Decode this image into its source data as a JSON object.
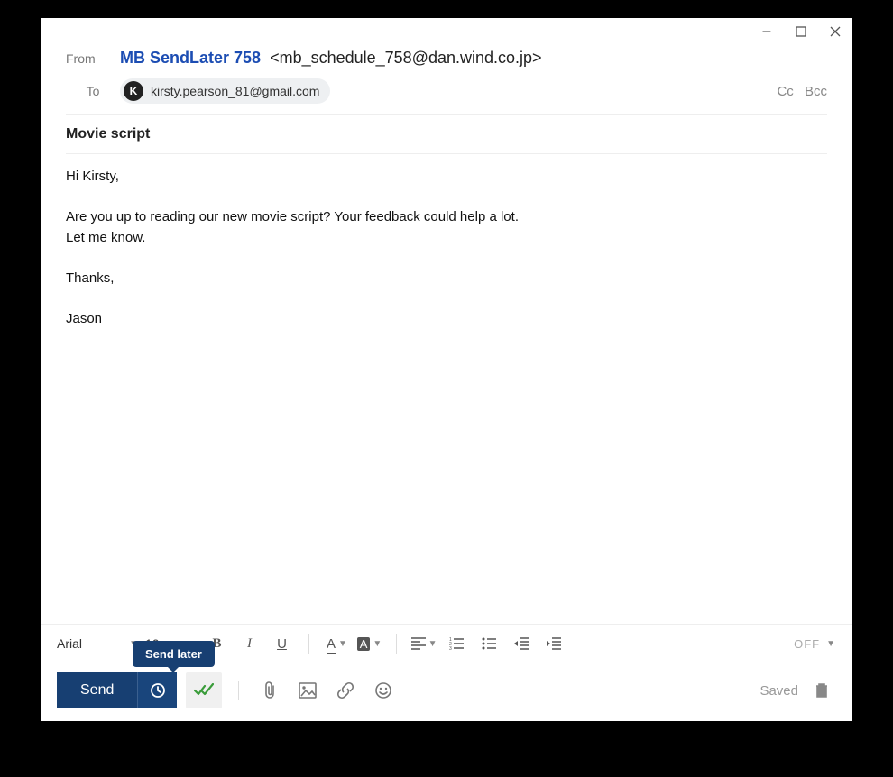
{
  "titlebar": {
    "minimize": "–",
    "maximize": "□",
    "close": "✕"
  },
  "header": {
    "from_label": "From",
    "from_name": "MB SendLater 758",
    "from_address": "<mb_schedule_758@dan.wind.co.jp>",
    "to_label": "To",
    "recipient": {
      "initial": "K",
      "address": "kirsty.pearson_81@gmail.com"
    },
    "cc": "Cc",
    "bcc": "Bcc"
  },
  "subject": "Movie script",
  "body": "Hi Kirsty,\n\nAre you up to reading our new movie script? Your feedback could help a lot.\nLet me know.\n\nThanks,\n\nJason",
  "format": {
    "font_name": "Arial",
    "font_size": "10",
    "off_label": "OFF"
  },
  "action": {
    "send": "Send",
    "send_later_tooltip": "Send later",
    "saved": "Saved"
  }
}
